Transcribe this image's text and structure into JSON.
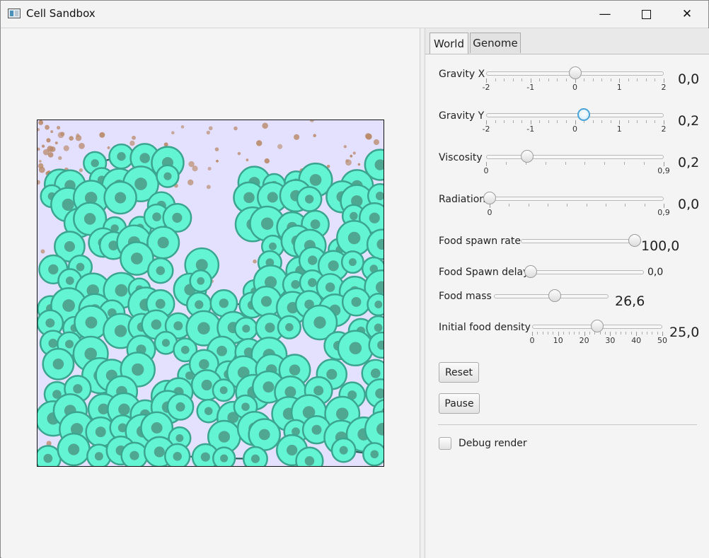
{
  "window": {
    "title": "Cell Sandbox",
    "icon": "app-window-icon",
    "controls": [
      "minimize-icon",
      "maximize-icon",
      "close-icon"
    ]
  },
  "tabs": {
    "world": "World",
    "genome": "Genome"
  },
  "controls": {
    "gravity_x": {
      "label": "Gravity X",
      "value": "0,0",
      "level": 0.5,
      "ticks": [
        "-2",
        "-1",
        "0",
        "1",
        "2"
      ]
    },
    "gravity_y": {
      "label": "Gravity Y",
      "value": "0,2",
      "level": 0.55,
      "ticks": [
        "-2",
        "-1",
        "0",
        "1",
        "2"
      ]
    },
    "viscosity": {
      "label": "Viscosity",
      "value": "0,2",
      "level": 0.23,
      "ticks": [
        "0",
        "0,9"
      ]
    },
    "radiation": {
      "label": "Radiation",
      "value": "0,0",
      "level": 0.0,
      "ticks": [
        "0",
        "0,9"
      ]
    },
    "food_spawn_rate": {
      "label": "Food spawn rate",
      "value": "100,0",
      "level": 1.0
    },
    "food_spawn_delay": {
      "label": "Food Spawn delay",
      "value": "0,0",
      "level": 0.0
    },
    "food_mass": {
      "label": "Food mass",
      "value": "26,6",
      "level": 0.53
    },
    "initial_food_density": {
      "label": "Initial food density",
      "value": "25,0",
      "level": 0.5,
      "ticks": [
        "0",
        "10",
        "20",
        "30",
        "40",
        "50"
      ]
    }
  },
  "buttons": {
    "reset": "Reset",
    "pause": "Pause"
  },
  "checkbox": {
    "debug_render": "Debug render",
    "checked": false
  },
  "colors": {
    "world_background": "#e4e0ff",
    "cell_fill": "#63f4d3",
    "cell_outline": "#3ca58f",
    "food": "#b98a69",
    "slider_focus": "#4aa3d8"
  }
}
